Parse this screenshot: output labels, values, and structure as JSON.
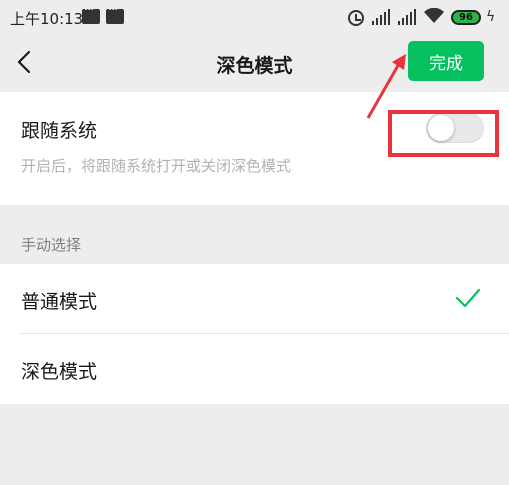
{
  "status_bar": {
    "time": "上午10:13",
    "signal_1_label": "HD",
    "signal_2_label": "HD",
    "battery": "96"
  },
  "header": {
    "title": "深色模式",
    "done_label": "完成",
    "accent_color": "#07c160"
  },
  "follow_system": {
    "label": "跟随系统",
    "description": "开启后，将跟随系统打开或关闭深色模式",
    "enabled": false
  },
  "manual_section": {
    "label": "手动选择",
    "options": [
      {
        "label": "普通模式",
        "selected": true
      },
      {
        "label": "深色模式",
        "selected": false
      }
    ]
  },
  "annotation_color": "#e8343c"
}
